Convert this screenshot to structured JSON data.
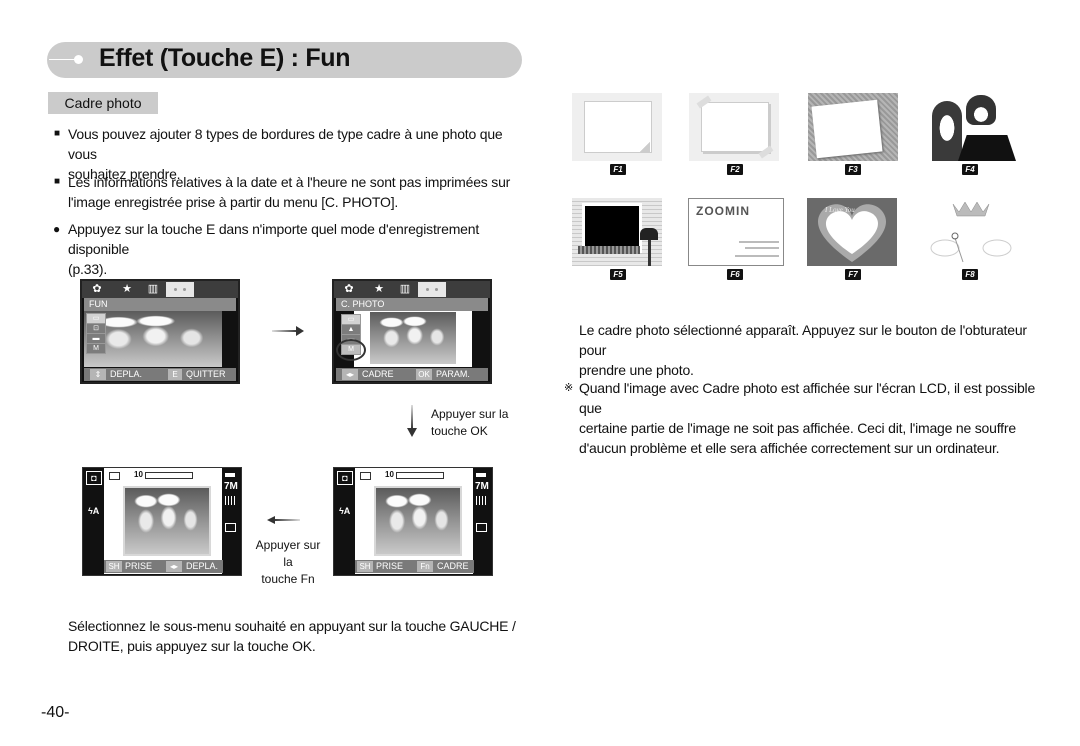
{
  "header": {
    "title": "Effet (Touche E) : Fun",
    "subsection_tab": "Cadre photo"
  },
  "intro": {
    "bullets": [
      {
        "marker": "■",
        "text_line1": "Vous pouvez ajouter 8 types de bordures de type cadre à une photo que vous",
        "text_line2": "souhaitez prendre."
      },
      {
        "marker": "■",
        "text_line1": "Les informations relatives à la date et à l'heure ne sont pas imprimées sur",
        "text_line2": "l'image enregistrée prise à partir du menu [C. PHOTO]."
      },
      {
        "marker": "●",
        "text_line1": "Appuyez sur la touche E dans n'importe quel mode d'enregistrement disponible",
        "text_line2": "(p.33)."
      }
    ]
  },
  "screens": {
    "fun_menu": {
      "title": "FUN",
      "bottom_left_key": "⇕",
      "bottom_left_label": "DEPLA.",
      "bottom_right_key": "E",
      "bottom_right_label": "QUITTER",
      "side_items": [
        "▭",
        "⊡",
        "▬",
        "M"
      ]
    },
    "photo_frame_menu": {
      "title": "C. PHOTO",
      "bottom_left_key": "◂▸",
      "bottom_left_label": "CADRE",
      "bottom_right_key": "OK",
      "bottom_right_label": "PARAM.",
      "side_items": [
        "▭",
        "▲",
        "▬",
        "M"
      ]
    },
    "shoot_left": {
      "shots_remaining": "10",
      "bottom_left_key": "SH",
      "bottom_left_label": "PRISE",
      "bottom_right_key": "◂▸",
      "bottom_right_label": "DEPLA.",
      "flash_label": "ϟA",
      "size_label": "7M"
    },
    "shoot_right": {
      "shots_remaining": "10",
      "bottom_left_key": "SH",
      "bottom_left_label": "PRISE",
      "bottom_right_key": "Fn",
      "bottom_right_label": "CADRE",
      "flash_label": "ϟA",
      "size_label": "7M"
    }
  },
  "arrows": {
    "ok_caption_line1": "Appuyer sur la",
    "ok_caption_line2": "touche OK",
    "fn_caption_line1": "Appuyer sur la",
    "fn_caption_line2": "touche Fn"
  },
  "instruction": {
    "line1": "Sélectionnez le sous-menu souhaité en appuyant sur la touche GAUCHE /",
    "line2": "DROITE, puis appuyez sur la touche OK."
  },
  "frames": [
    {
      "badge": "F1",
      "name": "curled-paper-frame"
    },
    {
      "badge": "F2",
      "name": "taped-paper-frame"
    },
    {
      "badge": "F3",
      "name": "tilted-polaroid-frame"
    },
    {
      "badge": "F4",
      "name": "couple-cutout-frame"
    },
    {
      "badge": "F5",
      "name": "window-mailbox-frame"
    },
    {
      "badge": "F6",
      "name": "zoomin-card-frame",
      "card_text": "ZOOMIN"
    },
    {
      "badge": "F7",
      "name": "heart-frame",
      "card_text": "I Love You"
    },
    {
      "badge": "F8",
      "name": "crown-wings-frame"
    }
  ],
  "right_text": {
    "para1_line1": "Le cadre photo sélectionné apparaît. Appuyez sur le bouton de l'obturateur pour",
    "para1_line2": "prendre une photo.",
    "note_marker": "※",
    "note_line1": "Quand l'image avec Cadre photo est affichée sur l'écran LCD, il est possible que",
    "note_line2": "certaine partie de l'image ne soit pas affichée. Ceci dit, l'image ne souffre",
    "note_line3": "d'aucun problème et elle sera affichée correctement sur un ordinateur."
  },
  "page_number": "-40-"
}
